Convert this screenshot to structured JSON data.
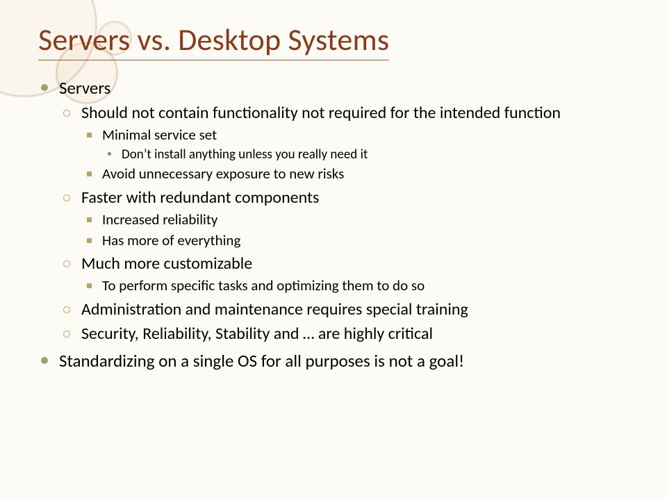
{
  "title": "Servers vs. Desktop Systems",
  "b1": "Servers",
  "b1_1": "Should not contain functionality not required for the intended function",
  "b1_1_1": "Minimal service set",
  "b1_1_1_1": "Don’t install anything unless you really need it",
  "b1_1_2": "Avoid unnecessary exposure to new risks",
  "b1_2": "Faster with redundant components",
  "b1_2_1": "Increased reliability",
  "b1_2_2": "Has more of everything",
  "b1_3": "Much more customizable",
  "b1_3_1": "To perform specific tasks and optimizing them to do so",
  "b1_4": "Administration and maintenance requires special training",
  "b1_5": "Security, Reliability, Stability and … are highly critical",
  "b2": "Standardizing on a single OS for all purposes is not a goal!"
}
